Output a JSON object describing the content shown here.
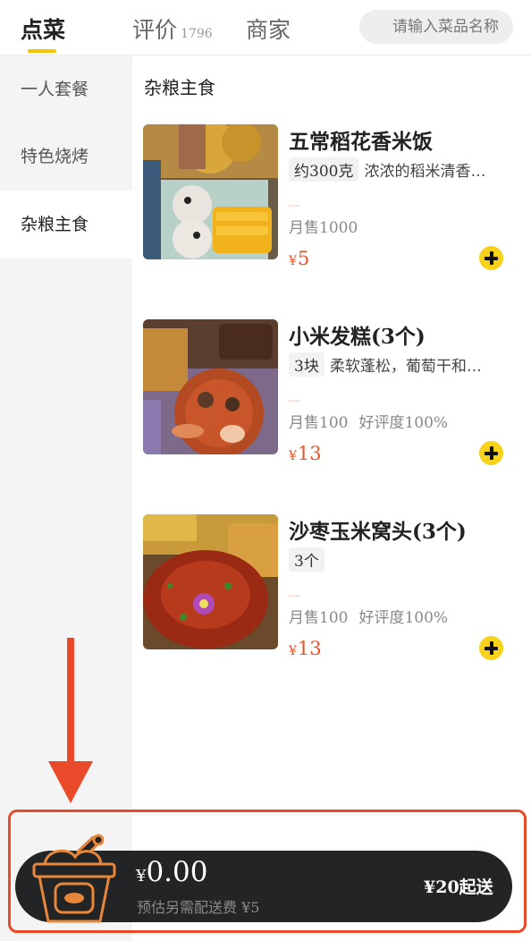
{
  "tabs": {
    "order": "点菜",
    "reviews": "评价",
    "reviews_count": "1796",
    "merchant": "商家"
  },
  "search": {
    "placeholder": "请输入菜品名称"
  },
  "sidebar": {
    "items": [
      {
        "label": "一人套餐",
        "active": false
      },
      {
        "label": "特色烧烤",
        "active": false
      },
      {
        "label": "杂粮主食",
        "active": true
      }
    ]
  },
  "main": {
    "section_title": "杂粮主食",
    "dishes": [
      {
        "name": "五常稻花香米饭",
        "tag": "约300克",
        "desc": "浓浓的稻米清香…",
        "sales": "月售1000",
        "rating": "",
        "currency": "¥",
        "price": "5"
      },
      {
        "name": "小米发糕(3个)",
        "tag": "3块",
        "desc": "柔软蓬松，葡萄干和…",
        "sales": "月售100",
        "rating": "好评度100%",
        "currency": "¥",
        "price": "13"
      },
      {
        "name": "沙枣玉米窝头(3个)",
        "tag": "3个",
        "desc": "",
        "sales": "月售100",
        "rating": "好评度100%",
        "currency": "¥",
        "price": "13"
      }
    ]
  },
  "cart": {
    "currency": "¥",
    "total": "0.00",
    "delivery_note": "预估另需配送费 ¥5",
    "min_order": "¥20起送"
  },
  "colors": {
    "accent_yellow": "#f7d21b",
    "price_red": "#e8542a",
    "cart_bg": "#222426",
    "annotation_red": "#e84a2a",
    "cart_icon_orange": "#e8873a"
  },
  "icons": {
    "add": "plus-circle-icon",
    "cart": "food-bucket-icon",
    "annotation": "down-arrow-icon"
  }
}
